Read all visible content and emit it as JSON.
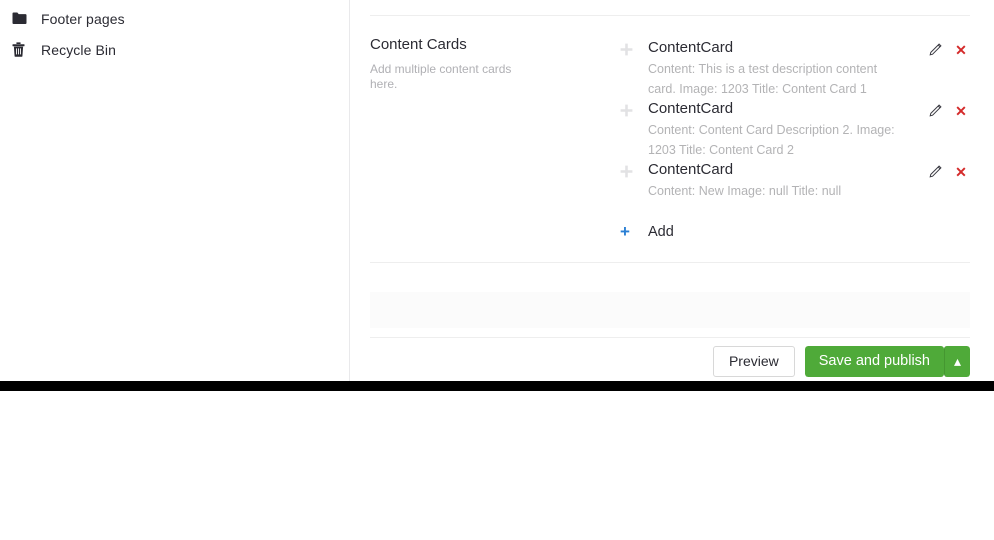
{
  "sidebar": {
    "items": [
      {
        "icon": "folder-icon",
        "label": "Footer pages"
      },
      {
        "icon": "trash-icon",
        "label": "Recycle Bin"
      }
    ]
  },
  "property": {
    "title": "Content Cards",
    "description": "Add multiple content cards here.",
    "items": [
      {
        "name": "ContentCard",
        "summary": "Content: This is a test description content card. Image: 1203 Title: Content Card 1",
        "drag_icon": "drag-move-icon",
        "edit_icon": "pencil-icon",
        "delete_icon": "close-x-icon"
      },
      {
        "name": "ContentCard",
        "summary": "Content: Content Card Description 2. Image: 1203 Title: Content Card 2",
        "drag_icon": "drag-move-icon",
        "edit_icon": "pencil-icon",
        "delete_icon": "close-x-icon"
      },
      {
        "name": "ContentCard",
        "summary": "Content: New Image: null Title: null",
        "drag_icon": "drag-move-icon",
        "edit_icon": "pencil-icon",
        "delete_icon": "close-x-icon"
      }
    ],
    "add_label": "Add",
    "add_plus": "+"
  },
  "footer": {
    "preview_label": "Preview",
    "publish_label": "Save and publish",
    "caret_glyph": "▴"
  },
  "colors": {
    "publish_green": "#4faa39",
    "delete_red": "#d42a2a",
    "add_blue": "#2a7fd4",
    "muted_text": "#b3b3b5",
    "divider": "#eeeeee"
  }
}
